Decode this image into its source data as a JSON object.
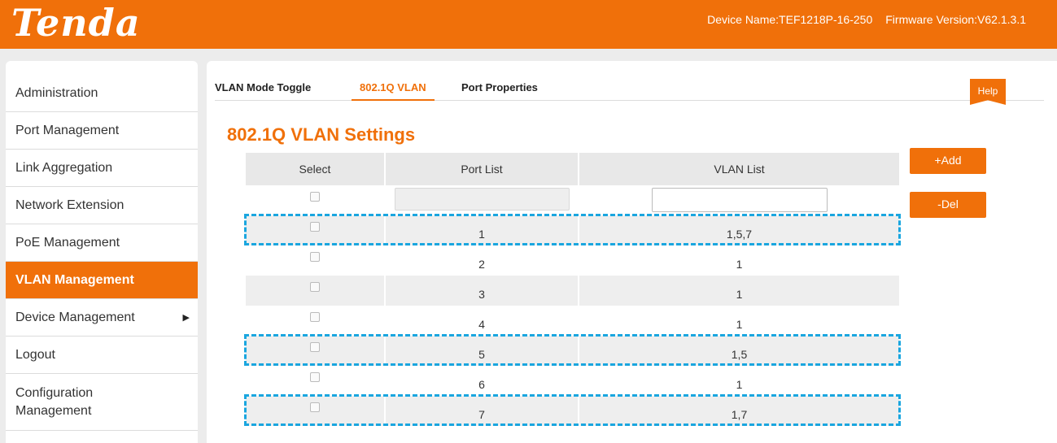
{
  "header": {
    "logo": "Tenda",
    "device_name": "Device Name:TEF1218P-16-250",
    "firmware": "Firmware Version:V62.1.3.1"
  },
  "sidebar": {
    "items": [
      {
        "label": "Administration"
      },
      {
        "label": "Port Management"
      },
      {
        "label": "Link Aggregation"
      },
      {
        "label": "Network Extension"
      },
      {
        "label": "PoE Management"
      },
      {
        "label": "VLAN Management"
      },
      {
        "label": "Device Management"
      },
      {
        "label": "Logout"
      },
      {
        "label": "Configuration Management"
      }
    ]
  },
  "tabs": [
    {
      "label": "VLAN Mode Toggle"
    },
    {
      "label": "802.1Q VLAN"
    },
    {
      "label": "Port Properties"
    }
  ],
  "help_label": "Help",
  "page_title": "802.1Q VLAN Settings",
  "table": {
    "headers": [
      "Select",
      "Port List",
      "VLAN List"
    ],
    "rows": [
      {
        "port": "1",
        "vlan": "1,5,7"
      },
      {
        "port": "2",
        "vlan": "1"
      },
      {
        "port": "3",
        "vlan": "1"
      },
      {
        "port": "4",
        "vlan": "1"
      },
      {
        "port": "5",
        "vlan": "1,5"
      },
      {
        "port": "6",
        "vlan": "1"
      },
      {
        "port": "7",
        "vlan": "1,7"
      }
    ]
  },
  "buttons": {
    "add": "+Add",
    "del": "-Del"
  },
  "colors": {
    "accent": "#f0700a",
    "highlight": "#1aa6df"
  }
}
